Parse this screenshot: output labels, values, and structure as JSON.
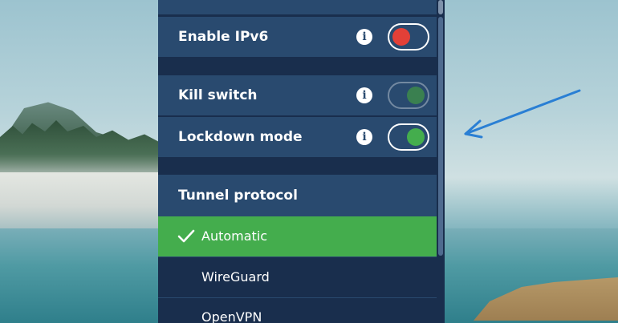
{
  "settings": {
    "enable_ipv6": {
      "label": "Enable IPv6",
      "info_glyph": "i",
      "enabled": false
    },
    "kill_switch": {
      "label": "Kill switch",
      "info_glyph": "i",
      "enabled": true,
      "disabled": true
    },
    "lockdown_mode": {
      "label": "Lockdown mode",
      "info_glyph": "i",
      "enabled": true
    }
  },
  "tunnel_protocol": {
    "heading": "Tunnel protocol",
    "options": [
      {
        "label": "Automatic",
        "selected": true
      },
      {
        "label": "WireGuard",
        "selected": false
      },
      {
        "label": "OpenVPN",
        "selected": false
      }
    ]
  },
  "colors": {
    "panel_bg": "#192e4d",
    "row_bg": "#294a6f",
    "toggle_off": "#e34037",
    "toggle_on": "#44ad4d",
    "selected_bg": "#44ad4d",
    "annotation_arrow": "#2a7fd4"
  },
  "icons": {
    "info": "info-icon",
    "check": "checkmark-icon",
    "annotation": "arrow-annotation-icon"
  }
}
